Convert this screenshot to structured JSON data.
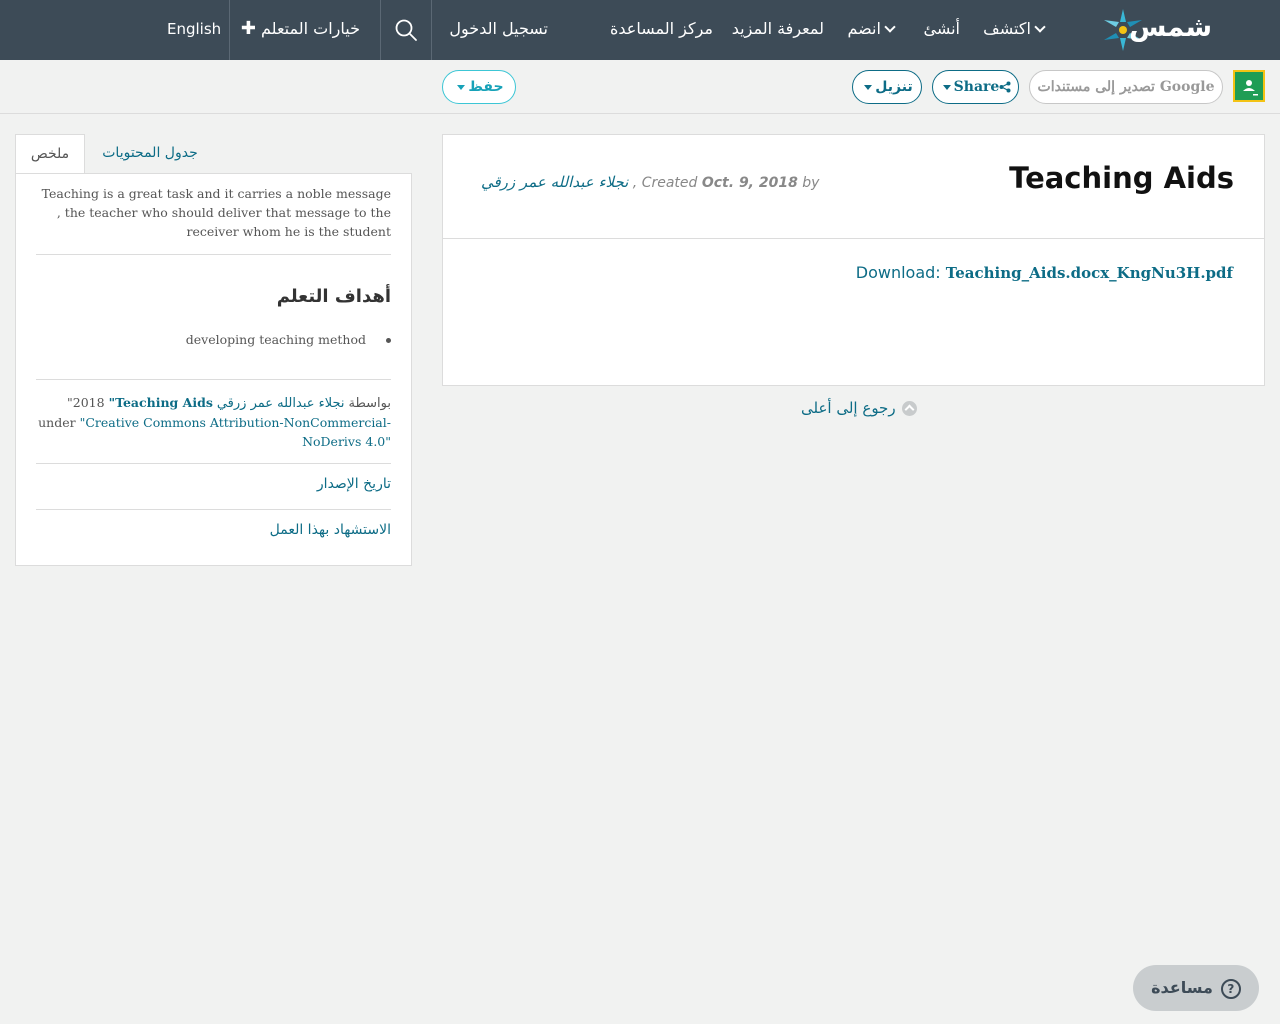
{
  "nav": {
    "logo": "شمس",
    "explore": "اكتشف",
    "create": "أنشئ",
    "join": "انضم",
    "learn_more": "لمعرفة المزيد",
    "help_center": "مركز المساعدة",
    "login": "تسجيل الدخول",
    "learner_options": "خيارات المتعلم",
    "language": "English"
  },
  "toolbar": {
    "export_gdocs": "تصدير إلى مستندات Google",
    "share": "Share",
    "download": "تنزيل",
    "save": "حفظ"
  },
  "resource": {
    "title": "Teaching Aids",
    "by_label": "by",
    "author": "نجلاء عبدالله عمر زرقي",
    "created_label": "Created",
    "date": "Oct. 9, 2018",
    "download_label": "Download:",
    "file_name": "Teaching_Aids.docx_KngNu3H.pdf",
    "back_to_top": "رجوع إلى أعلى"
  },
  "sidebar": {
    "tabs": {
      "summary": "ملخص",
      "contents": "جدول المحتويات"
    },
    "summary_text": "Teaching is a great task and it carries a noble message , the teacher who should deliver that message to the receiver whom he is the student",
    "objectives_title": "أهداف التعلم",
    "objectives": [
      "developing teaching method"
    ],
    "attribution": {
      "quote_open": "\"",
      "title": "Teaching Aids",
      "quote_title": "\"",
      "year": "2018",
      "by_word": "بواسطة",
      "author": "نجلاء عبدالله عمر زرقي",
      "under": "under",
      "license": "\"Creative Commons Attribution-NonCommercial-NoDerivs 4.0\""
    },
    "release_history": "تاريخ الإصدار",
    "cite_work": "الاستشهاد بهذا العمل"
  },
  "help": {
    "label": "مساعدة",
    "icon": "question-circle-icon"
  },
  "colors": {
    "nav_bg": "#3d4b57",
    "link": "#0d6c86",
    "page_bg": "#f1f2f1",
    "save_border": "#3cc6d5"
  }
}
